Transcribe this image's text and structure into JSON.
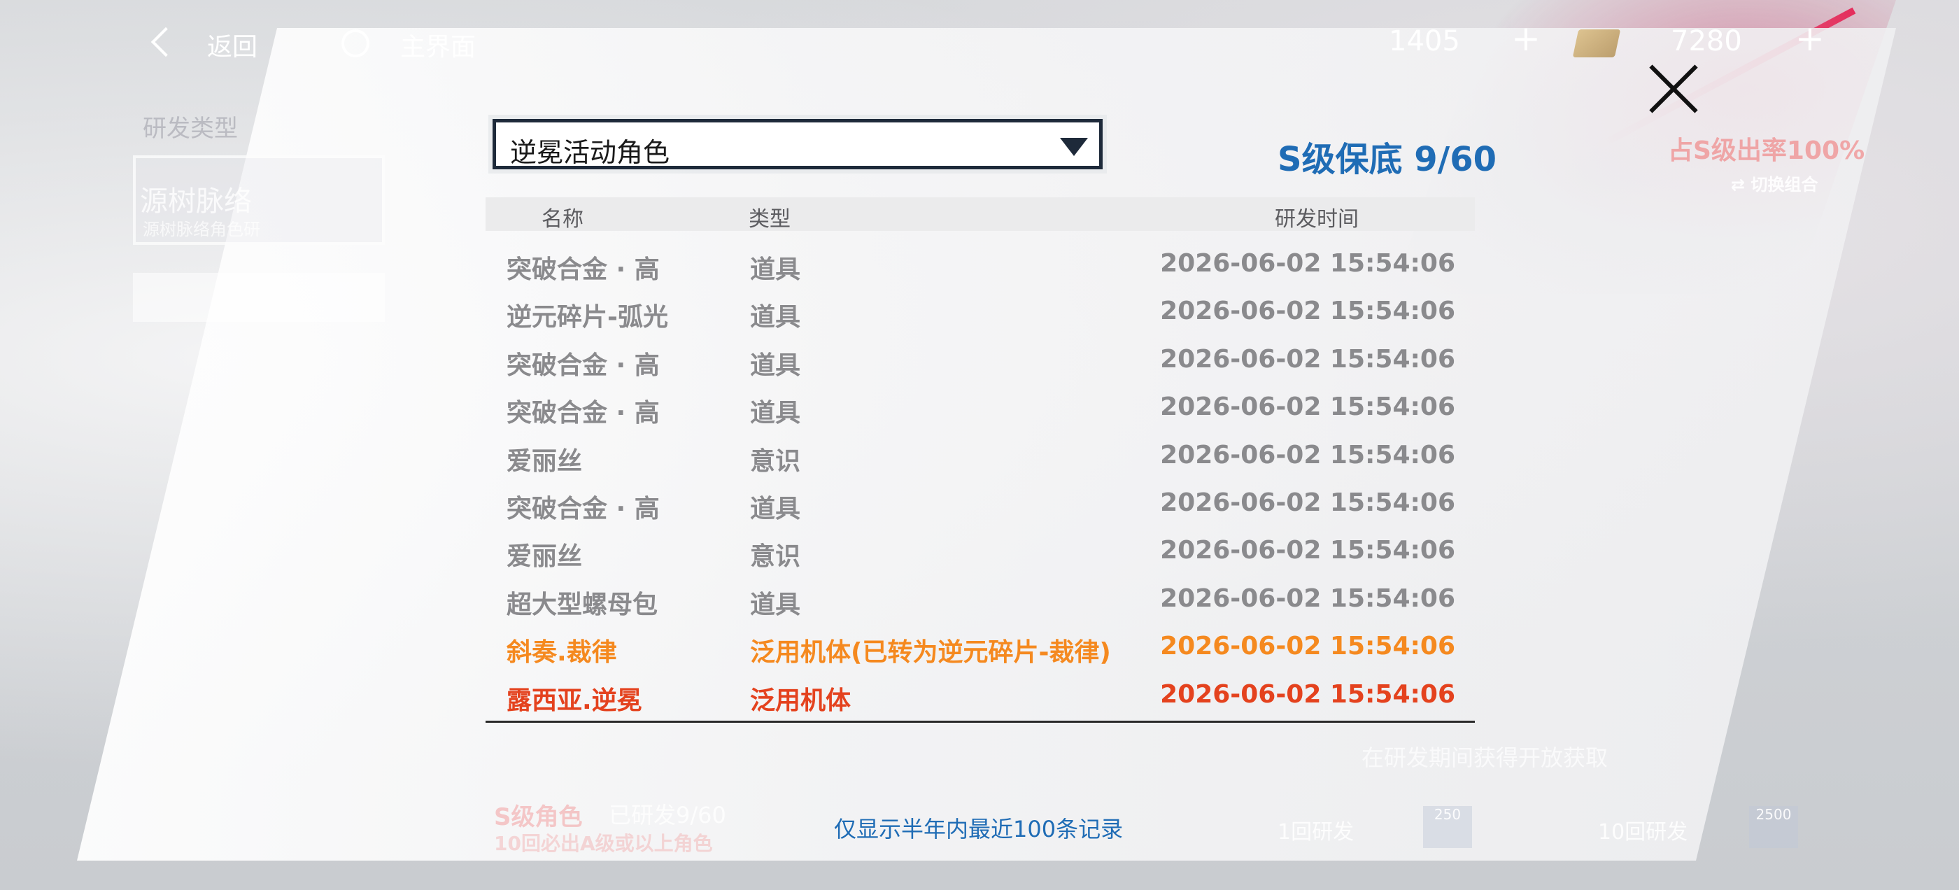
{
  "topbar": {
    "back_label": "返回",
    "home_label": "主界面",
    "resource1_value": "1405",
    "resource1_plus": "+",
    "resource2_value": "7280",
    "resource2_plus": "+"
  },
  "background": {
    "section_label": "研发类型",
    "card_title": "源树脉络",
    "card_subtitle": "源树脉络角色研",
    "rate_text": "占S级出率100%",
    "switch_label": "切换组合",
    "s_role_label": "S级角色",
    "pity_text": "已研发9/60",
    "guarantee_text": "10回必出A级或以上角色",
    "single_label": "1回研发",
    "single_cost": "250",
    "ten_label": "10回研发",
    "ten_cost": "2500",
    "hint_text": "在研发期间获得开放获取"
  },
  "dialog": {
    "dropdown_value": "逆冕活动角色",
    "pity_label": "S级保底 9/60",
    "columns": {
      "name": "名称",
      "type": "类型",
      "time": "研发时间"
    },
    "rows": [
      {
        "name": "突破合金 · 高",
        "type": "道具",
        "time": "2026-06-02 15:54:06",
        "rarity": "normal"
      },
      {
        "name": "逆元碎片-弧光",
        "type": "道具",
        "time": "2026-06-02 15:54:06",
        "rarity": "normal"
      },
      {
        "name": "突破合金 · 高",
        "type": "道具",
        "time": "2026-06-02 15:54:06",
        "rarity": "normal"
      },
      {
        "name": "突破合金 · 高",
        "type": "道具",
        "time": "2026-06-02 15:54:06",
        "rarity": "normal"
      },
      {
        "name": "爱丽丝",
        "type": "意识",
        "time": "2026-06-02 15:54:06",
        "rarity": "normal"
      },
      {
        "name": "突破合金 · 高",
        "type": "道具",
        "time": "2026-06-02 15:54:06",
        "rarity": "normal"
      },
      {
        "name": "爱丽丝",
        "type": "意识",
        "time": "2026-06-02 15:54:06",
        "rarity": "normal"
      },
      {
        "name": "超大型螺母包",
        "type": "道具",
        "time": "2026-06-02 15:54:06",
        "rarity": "normal"
      },
      {
        "name": "斜奏.裁律",
        "type": "泛用机体(已转为逆元碎片-裁律)",
        "time": "2026-06-02 15:54:06",
        "rarity": "a"
      },
      {
        "name": "露西亚.逆冕",
        "type": "泛用机体",
        "time": "2026-06-02 15:54:06",
        "rarity": "s"
      }
    ],
    "footnote": "仅显示半年内最近100条记录"
  },
  "colors": {
    "accent_blue": "#1f6cb5",
    "rarity_a": "#f5891f",
    "rarity_s": "#e4421e",
    "normal_text": "#8a8a8d"
  }
}
